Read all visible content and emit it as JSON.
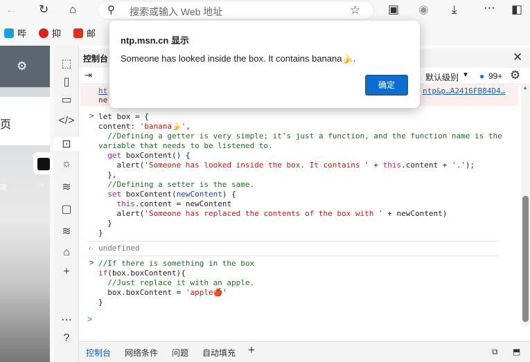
{
  "toolbar": {
    "address_placeholder": "搜索或输入 Web 地址"
  },
  "bookmarks": [
    {
      "label": "哔",
      "color": "#1ea0e0"
    },
    {
      "label": "抑",
      "color": "#e02020"
    },
    {
      "label": "邮",
      "color": "#e03020"
    }
  ],
  "page": {
    "text1": "页",
    "text2": "理",
    "text3": "Git"
  },
  "devtools": {
    "title": "控制台",
    "filter_level": "默认级别",
    "issues_count": "99+",
    "error_link": "ht",
    "error_link_right": "ntp&p…A2416FB84D4…",
    "error_text": "ne",
    "code1": [
      "let box = {",
      "content: 'banana🍌',",
      "  //Defining a getter is very simple; it's just a function, and the function name is the",
      "variable that needs to be listened to.",
      "  get boxContent() {",
      "    alert('Someone has looked inside the box. It contains ' + this.content + '.');",
      "  },",
      "  //Defining a setter is the same.",
      "  set boxContent(newContent) {",
      "    this.content = newContent",
      "    alert('Someone has replaced the contents of the box with ' + newContent)",
      "  }",
      "}"
    ],
    "result1": "undefined",
    "code2": [
      "//If there is something in the box",
      "if(box.boxContent){",
      "  //Just replace it with an apple.",
      "  box.boxContent = 'apple🍎'",
      "}"
    ],
    "bottom_tabs": [
      "控制台",
      "网络条件",
      "问题",
      "自动填充"
    ]
  },
  "dialog": {
    "title": "ntp.msn.cn 显示",
    "message": "Someone has looked inside the box. It contains banana🍌.",
    "ok_label": "确定"
  }
}
